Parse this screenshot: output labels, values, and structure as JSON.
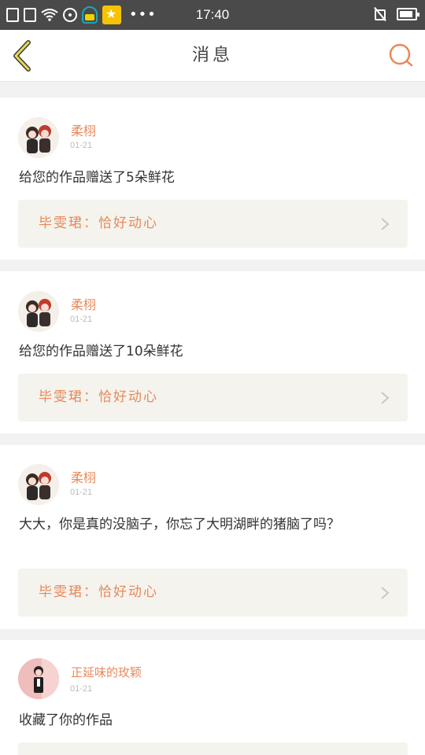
{
  "status_bar": {
    "time": "17:40",
    "dots": "•••",
    "icons": [
      "sim-icon",
      "sim-icon",
      "wifi-icon",
      "disc-icon",
      "app-notification-icon",
      "star-app-icon",
      "mute-icon",
      "battery-icon"
    ]
  },
  "header": {
    "title": "消息",
    "back_icon": "chevron-left-icon",
    "search_icon": "search-icon"
  },
  "colors": {
    "accent": "#e8895a",
    "back_chevron": "#d9c52a",
    "background": "#f2f2f2"
  },
  "notifications": [
    {
      "username": "柔栩",
      "date": "01-21",
      "message": "给您的作品赠送了5朵鲜花",
      "work": "毕雯珺：恰好动心"
    },
    {
      "username": "柔栩",
      "date": "01-21",
      "message": "给您的作品赠送了10朵鲜花",
      "work": "毕雯珺：恰好动心"
    },
    {
      "username": "柔栩",
      "date": "01-21",
      "message": "大大，你是真的没脑子，你忘了大明湖畔的猪脑了吗？",
      "work": "毕雯珺：恰好动心"
    },
    {
      "username": "正延味的玫颖",
      "date": "01-21",
      "message": "收藏了你的作品",
      "work": ""
    }
  ]
}
